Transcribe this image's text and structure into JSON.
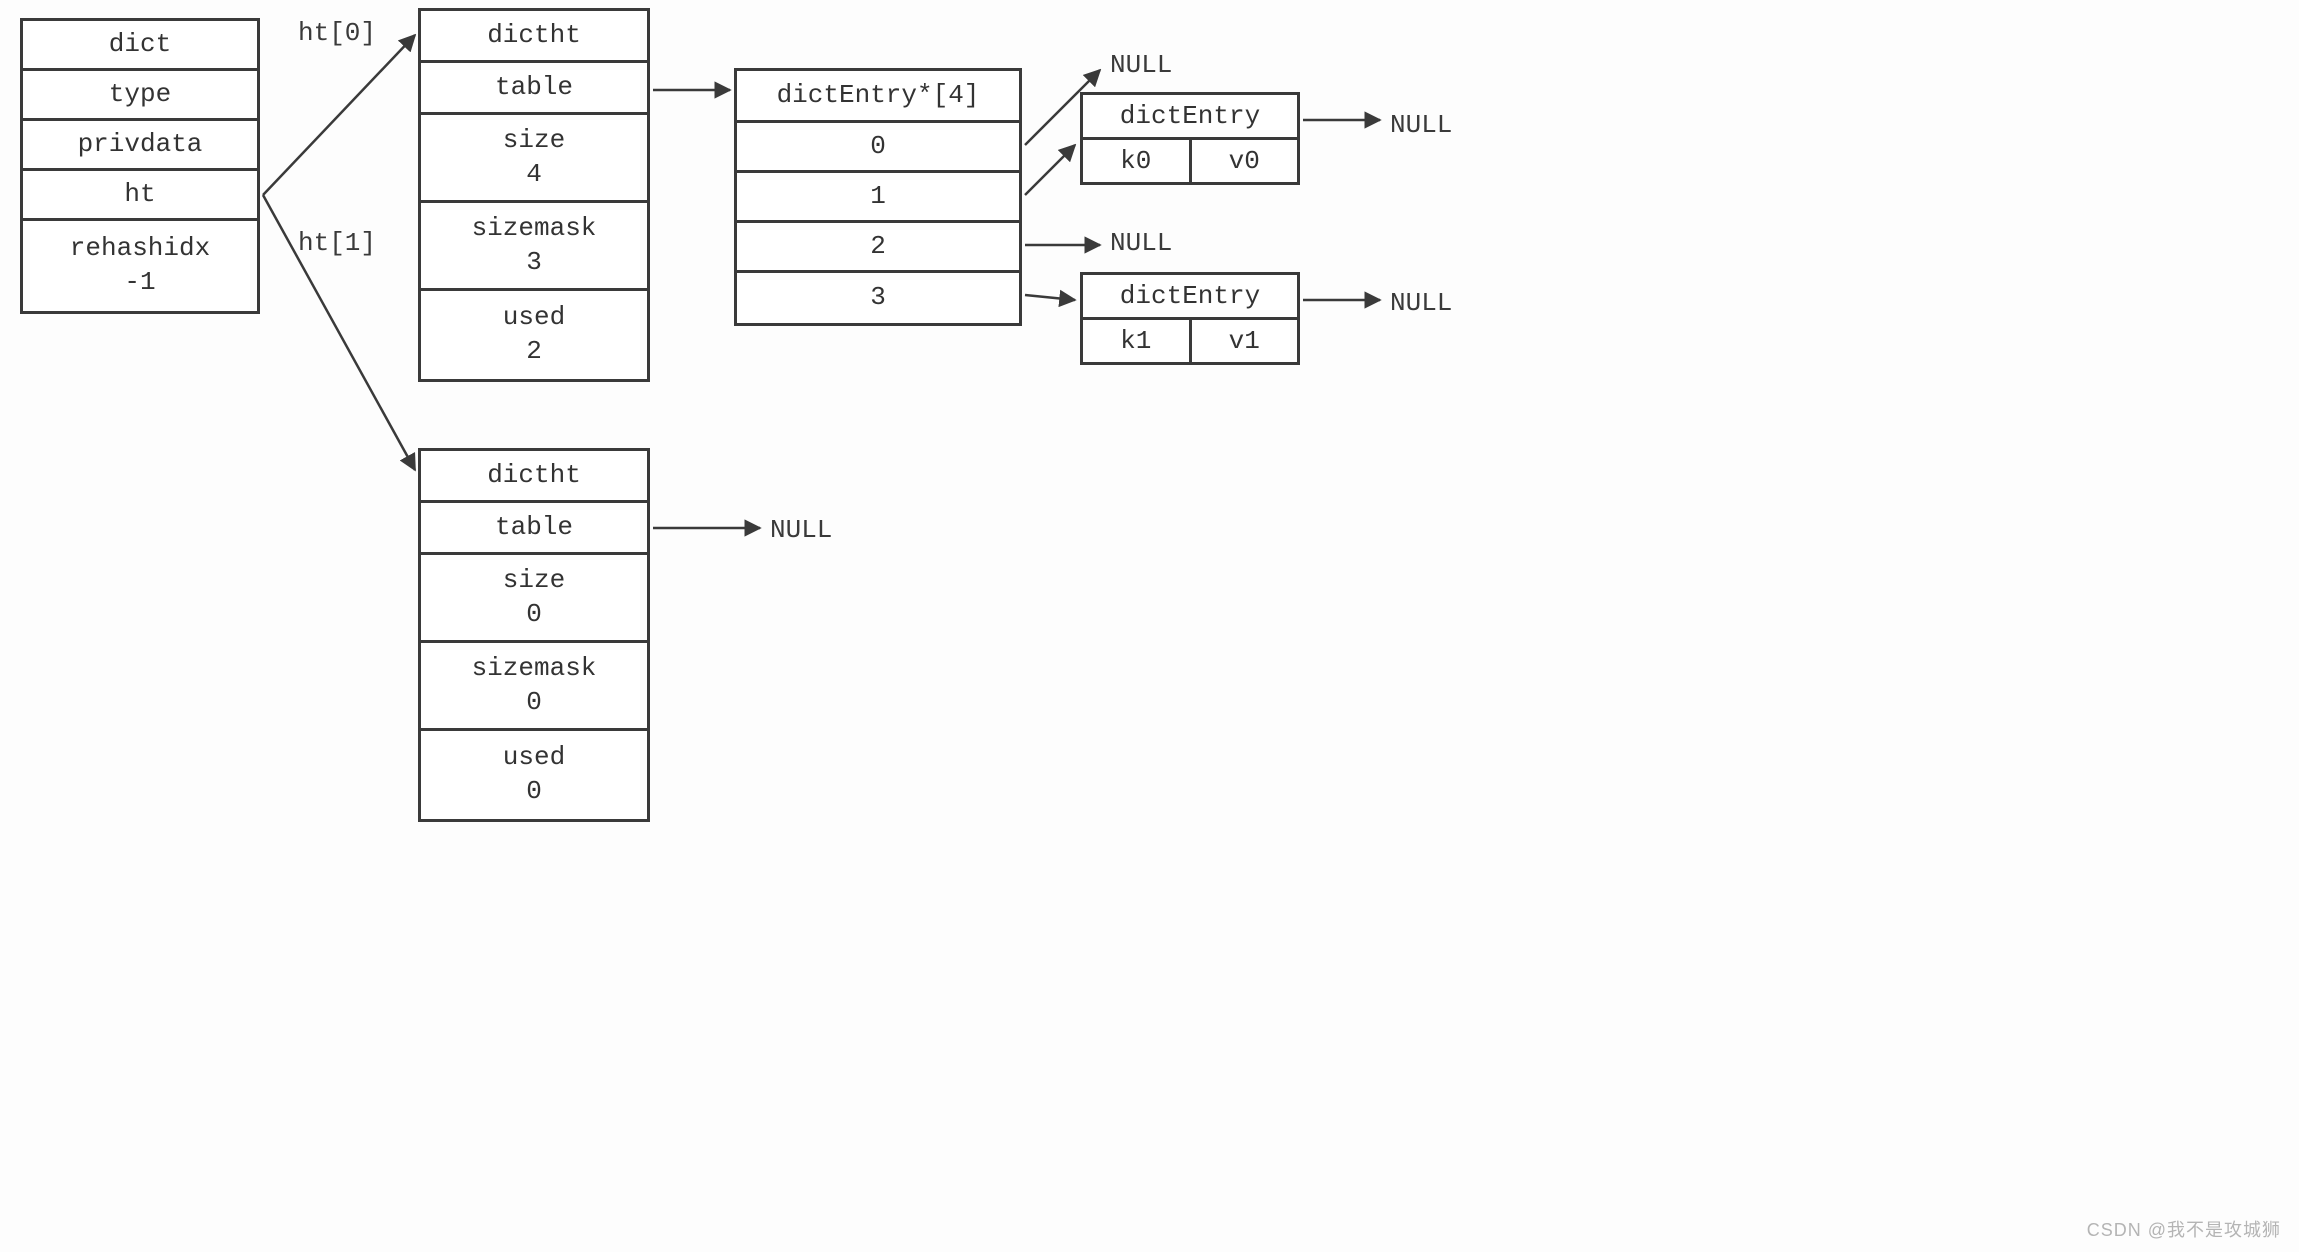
{
  "dict": {
    "title": "dict",
    "fields": [
      "type",
      "privdata",
      "ht"
    ],
    "rehashidx_label": "rehashidx",
    "rehashidx_value": "-1"
  },
  "ht_labels": {
    "ht0": "ht[0]",
    "ht1": "ht[1]"
  },
  "dictht0": {
    "title": "dictht",
    "table": "table",
    "size_label": "size",
    "size_value": "4",
    "sizemask_label": "sizemask",
    "sizemask_value": "3",
    "used_label": "used",
    "used_value": "2"
  },
  "dictht1": {
    "title": "dictht",
    "table": "table",
    "size_label": "size",
    "size_value": "0",
    "sizemask_label": "sizemask",
    "sizemask_value": "0",
    "used_label": "used",
    "used_value": "0"
  },
  "entry_array": {
    "title": "dictEntry*[4]",
    "slots": [
      "0",
      "1",
      "2",
      "3"
    ]
  },
  "nulls": {
    "n0": "NULL",
    "n1": "NULL",
    "n2": "NULL",
    "n3": "NULL",
    "n4": "NULL"
  },
  "entry0": {
    "title": "dictEntry",
    "k": "k0",
    "v": "v0"
  },
  "entry1": {
    "title": "dictEntry",
    "k": "k1",
    "v": "v1"
  },
  "watermark": "CSDN  @我不是攻城狮"
}
